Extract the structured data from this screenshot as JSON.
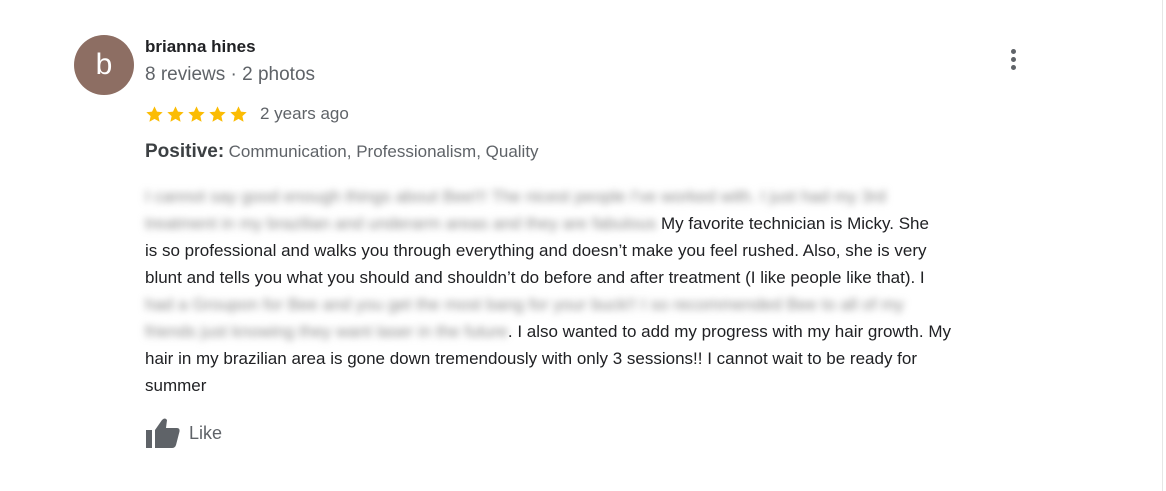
{
  "review": {
    "author": {
      "initial": "b",
      "name": "brianna hines",
      "meta": "8 reviews · 2 photos"
    },
    "rating": {
      "stars": 5,
      "max": 5,
      "star_color": "#fbbc04"
    },
    "date": "2 years ago",
    "positive": {
      "label": "Positive:",
      "values": "Communication, Professionalism, Quality"
    },
    "body": {
      "clear_1": " My favorite technician is Micky. She",
      "line_3": "is so professional and walks you through everything and doesn’t make you feel rushed. Also, she is very",
      "line_4": "blunt and tells you what you should and shouldn’t do before and after treatment (I like people like that). I",
      "clear_2": ". I also wanted to add my progress with my hair growth. My",
      "line_8": "hair in my brazilian area is gone down tremendously with only 3 sessions!! I cannot wait to be ready for",
      "line_9": "summer"
    },
    "like_label": "Like"
  },
  "colors": {
    "avatar_bg": "#8d6e63",
    "icon_grey": "#5f6368"
  },
  "icons": {
    "more": "more-vert-icon",
    "star": "star-icon",
    "like": "thumb-up-icon"
  }
}
